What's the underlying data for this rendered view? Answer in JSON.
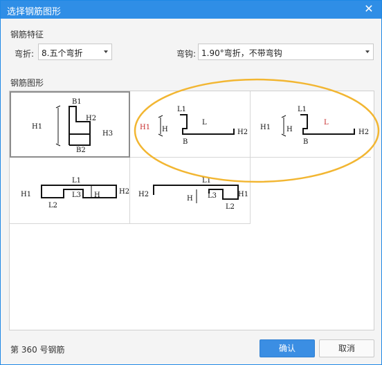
{
  "window": {
    "title": "选择钢筋图形"
  },
  "features": {
    "section_label": "钢筋特征",
    "bend_label": "弯折:",
    "bend_value": "8.五个弯折",
    "hook_label": "弯钩:",
    "hook_value": "1.90°弯折，不带弯钩"
  },
  "shapes": {
    "section_label": "钢筋图形",
    "cells": [
      {
        "labels": [
          "B1",
          "H1",
          "H2",
          "H3",
          "B2"
        ]
      },
      {
        "labels": [
          "L1",
          "L",
          "H1",
          "H",
          "B",
          "H2"
        ]
      },
      {
        "labels": [
          "L1",
          "L",
          "H1",
          "H",
          "B",
          "H2"
        ]
      },
      {
        "labels": [
          "L1",
          "H1",
          "L3",
          "H",
          "H2",
          "L2"
        ]
      },
      {
        "labels": [
          "L1",
          "H2",
          "H",
          "L3",
          "H1",
          "L2"
        ]
      }
    ]
  },
  "footer": {
    "status": "第 360 号钢筋",
    "ok_label": "确认",
    "cancel_label": "取消"
  },
  "colors": {
    "titlebar": "#2f8ee6",
    "primary_button": "#3b8ee3",
    "highlight": "#f2b632",
    "label_red": "#c62828"
  }
}
